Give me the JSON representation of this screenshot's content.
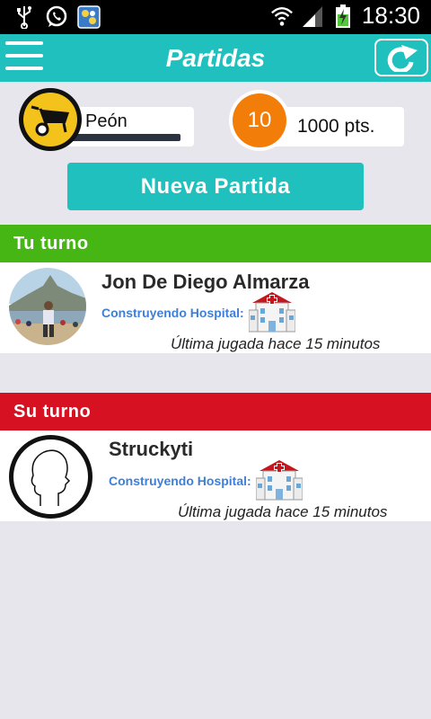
{
  "status_bar": {
    "time": "18:30",
    "left_icons": [
      "usb-icon",
      "whatsapp-icon",
      "game-app-icon"
    ],
    "right_icons": [
      "wifi-icon",
      "signal-icon",
      "battery-charging-icon"
    ]
  },
  "header": {
    "title": "Partidas",
    "menu_icon": "hamburger-menu-icon",
    "refresh_icon": "refresh-icon"
  },
  "profile": {
    "rank_label": "Peón",
    "rank_icon": "wheelbarrow-icon",
    "rank_progress": 1.0,
    "level": "10",
    "points": "1000 pts."
  },
  "new_game_button": "Nueva Partida",
  "sections": {
    "your_turn": {
      "title": "Tu turno",
      "color": "#46b614",
      "game": {
        "player": "Jon De Diego Almarza",
        "status_label": "Construyendo Hospital:",
        "building_icon": "hospital-icon",
        "last_move": "Última jugada hace 15 minutos"
      }
    },
    "their_turn": {
      "title": "Su turno",
      "color": "#d51122",
      "game": {
        "player": "Struckyti",
        "status_label": "Construyendo Hospital:",
        "building_icon": "hospital-icon",
        "last_move": "Última jugada hace 15 minutos"
      }
    }
  },
  "colors": {
    "accent": "#1fc0bd",
    "status_label": "#3e7fd9",
    "level_orange": "#f27d08",
    "rank_yellow": "#f3c21b"
  }
}
